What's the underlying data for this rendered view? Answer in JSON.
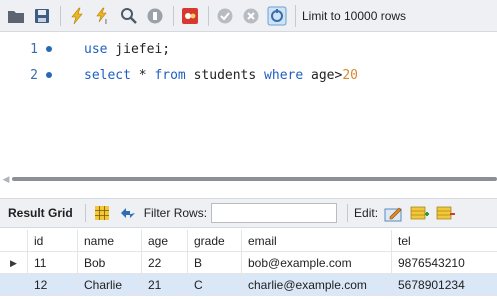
{
  "toolbar": {
    "limit_label": "Limit to 10000 rows"
  },
  "editor": {
    "lines": [
      {
        "number": "1",
        "parts": [
          "use",
          " jiefei;"
        ]
      },
      {
        "number": "2",
        "parts": [
          "select",
          " * ",
          "from",
          " students ",
          "where",
          " age>",
          "20"
        ]
      }
    ]
  },
  "result_toolbar": {
    "result_grid_label": "Result Grid",
    "filter_rows_label": "Filter Rows:",
    "filter_value": "",
    "edit_label": "Edit:"
  },
  "grid": {
    "columns": [
      "id",
      "name",
      "age",
      "grade",
      "email",
      "tel"
    ],
    "rows": [
      [
        "11",
        "Bob",
        "22",
        "B",
        "bob@example.com",
        "9876543210"
      ],
      [
        "12",
        "Charlie",
        "21",
        "C",
        "charlie@example.com",
        "5678901234"
      ]
    ]
  },
  "colors": {
    "keyword": "#1f5fbf",
    "number": "#d8892f",
    "line_number": "#3e6ea3",
    "selected_row": "#d9e7f7"
  }
}
